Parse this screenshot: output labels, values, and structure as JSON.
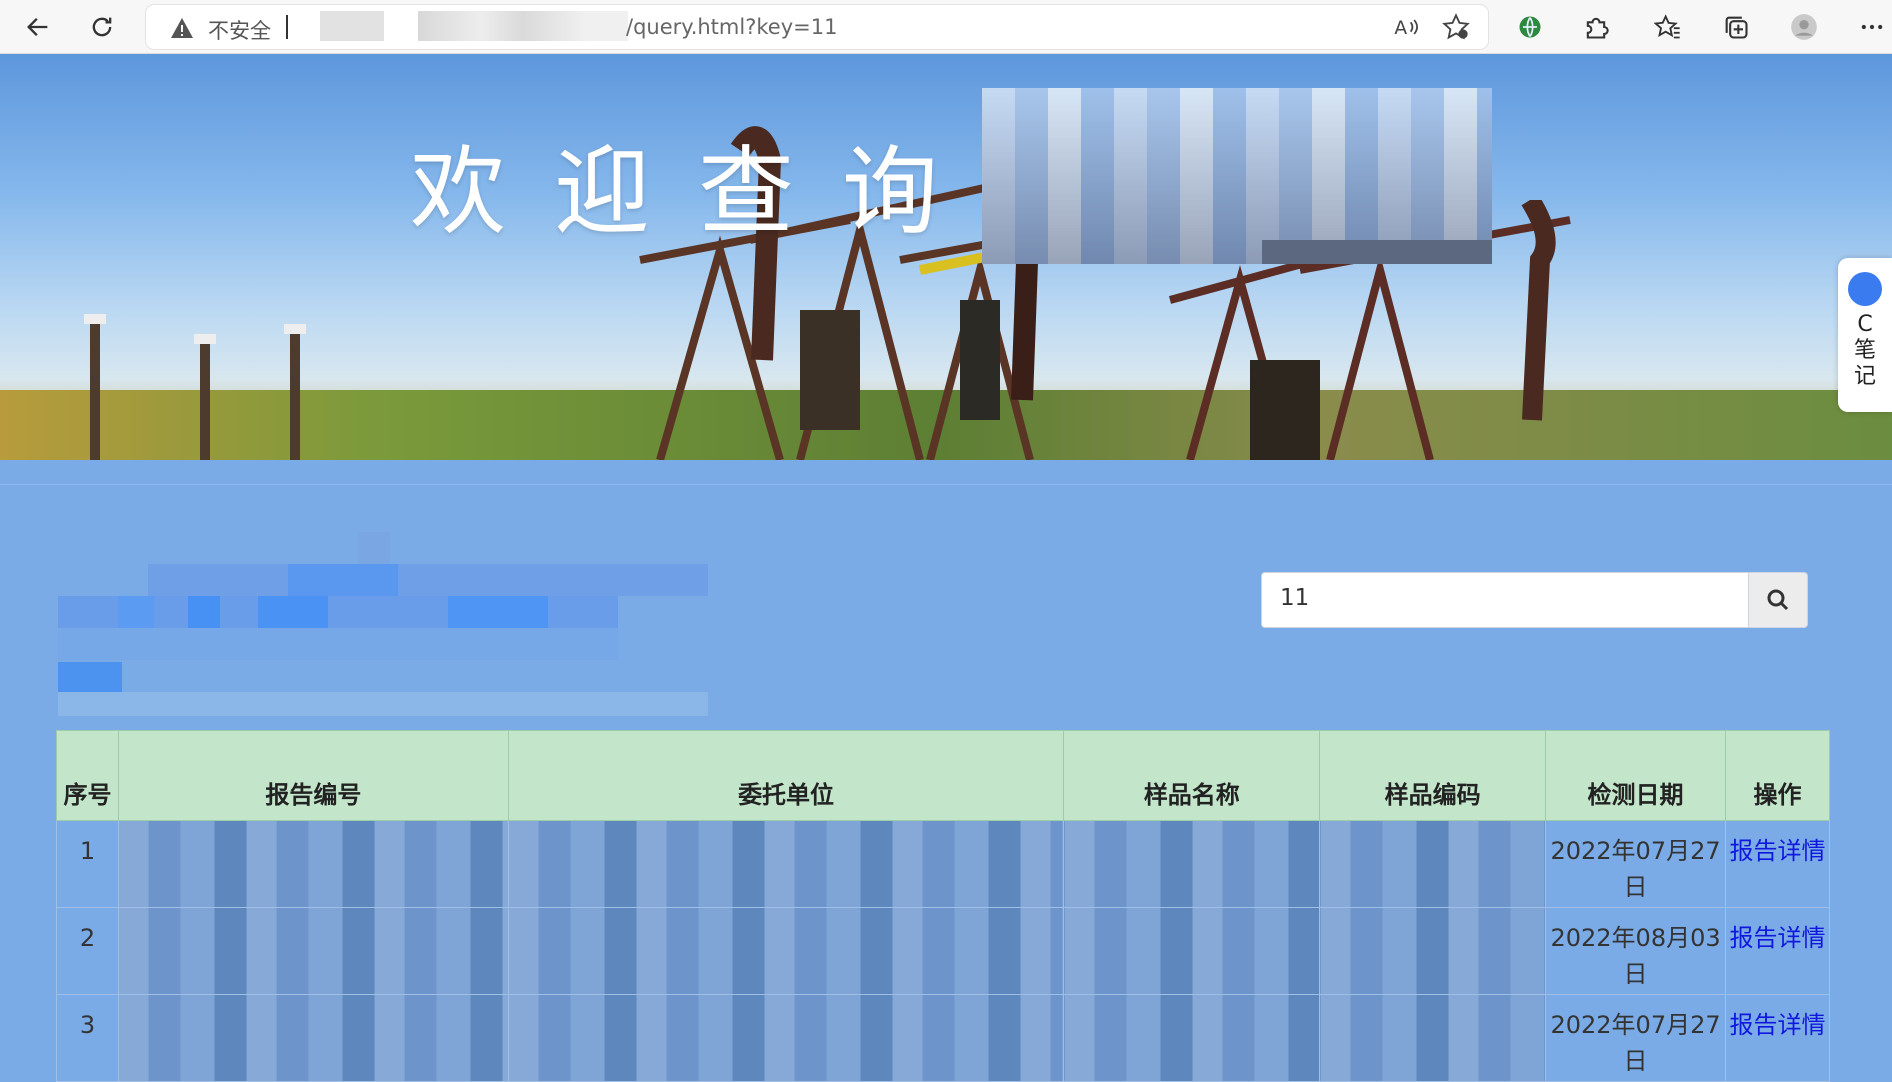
{
  "browser": {
    "insecure_label": "不安全",
    "url_visible": "/query.html?key=11",
    "icons": [
      "back-icon",
      "refresh-icon",
      "warning-icon",
      "read-aloud-icon",
      "add-favorite-icon",
      "extension-icon",
      "puzzle-icon",
      "favorites-icon",
      "collections-icon",
      "profile-icon",
      "more-icon"
    ]
  },
  "banner": {
    "welcome_text": "欢迎查询"
  },
  "side_widget": {
    "label": "C笔记"
  },
  "search": {
    "value": "11"
  },
  "table": {
    "headers": [
      "序号",
      "报告编号",
      "委托单位",
      "样品名称",
      "样品编码",
      "检测日期",
      "操作"
    ],
    "rows": [
      {
        "index": "1",
        "date": "2022年07月27日",
        "action": "报告详情"
      },
      {
        "index": "2",
        "date": "2022年08月03日",
        "action": "报告详情"
      },
      {
        "index": "3",
        "date": "2022年07月27日",
        "action": "报告详情"
      }
    ]
  },
  "colors": {
    "page_bg": "#7aabe6",
    "header_bg": "#c3e6cb",
    "link": "#1018e0"
  }
}
